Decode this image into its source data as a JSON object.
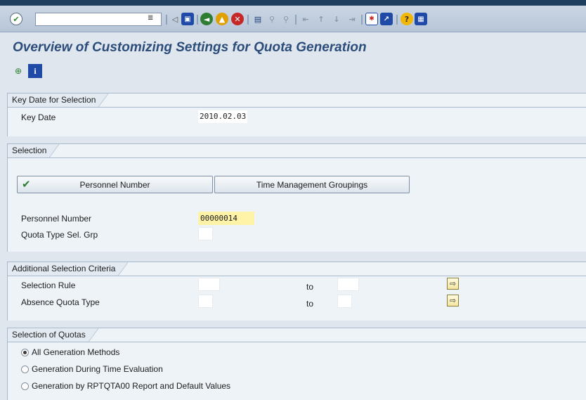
{
  "toolbar": {
    "command_field_value": "",
    "icons": [
      "enter-icon",
      "menu-icon",
      "back-icon",
      "save-icon",
      "back-nav-icon",
      "exit-icon",
      "cancel-icon",
      "print-icon",
      "find-icon",
      "find-next-icon",
      "first-page-icon",
      "previous-page-icon",
      "next-page-icon",
      "last-page-icon",
      "new-session-icon",
      "shortcut-icon",
      "help-icon",
      "layout-icon"
    ]
  },
  "page": {
    "title": "Overview of Customizing Settings for Quota Generation"
  },
  "app_toolbar": {
    "icons": [
      "execute-icon",
      "info-icon"
    ]
  },
  "key_date_section": {
    "tab_label": "Key Date for Selection",
    "key_date_label": "Key Date",
    "key_date_value": "2010.02.03"
  },
  "selection_section": {
    "tab_label": "Selection",
    "tab_button_1": "Personnel Number",
    "tab_button_2": "Time Management Groupings",
    "personnel_number_label": "Personnel Number",
    "personnel_number_value": "00000014",
    "quota_type_sel_grp_label": "Quota Type Sel. Grp",
    "quota_type_sel_grp_value": ""
  },
  "additional_section": {
    "tab_label": "Additional Selection Criteria",
    "selection_rule_label": "Selection Rule",
    "absence_quota_type_label": "Absence Quota Type",
    "to_label": "to"
  },
  "quotas_section": {
    "tab_label": "Selection of Quotas",
    "options": [
      {
        "label": "All Generation Methods",
        "selected": true
      },
      {
        "label": "Generation During Time Evaluation",
        "selected": false
      },
      {
        "label": "Generation by RPTQTA00 Report and Default Values",
        "selected": false
      }
    ]
  },
  "colors": {
    "title": "#2c4d7a",
    "background": "#dfe6ee",
    "panel": "#eef3f8",
    "highlight_field": "#fff3a8"
  }
}
